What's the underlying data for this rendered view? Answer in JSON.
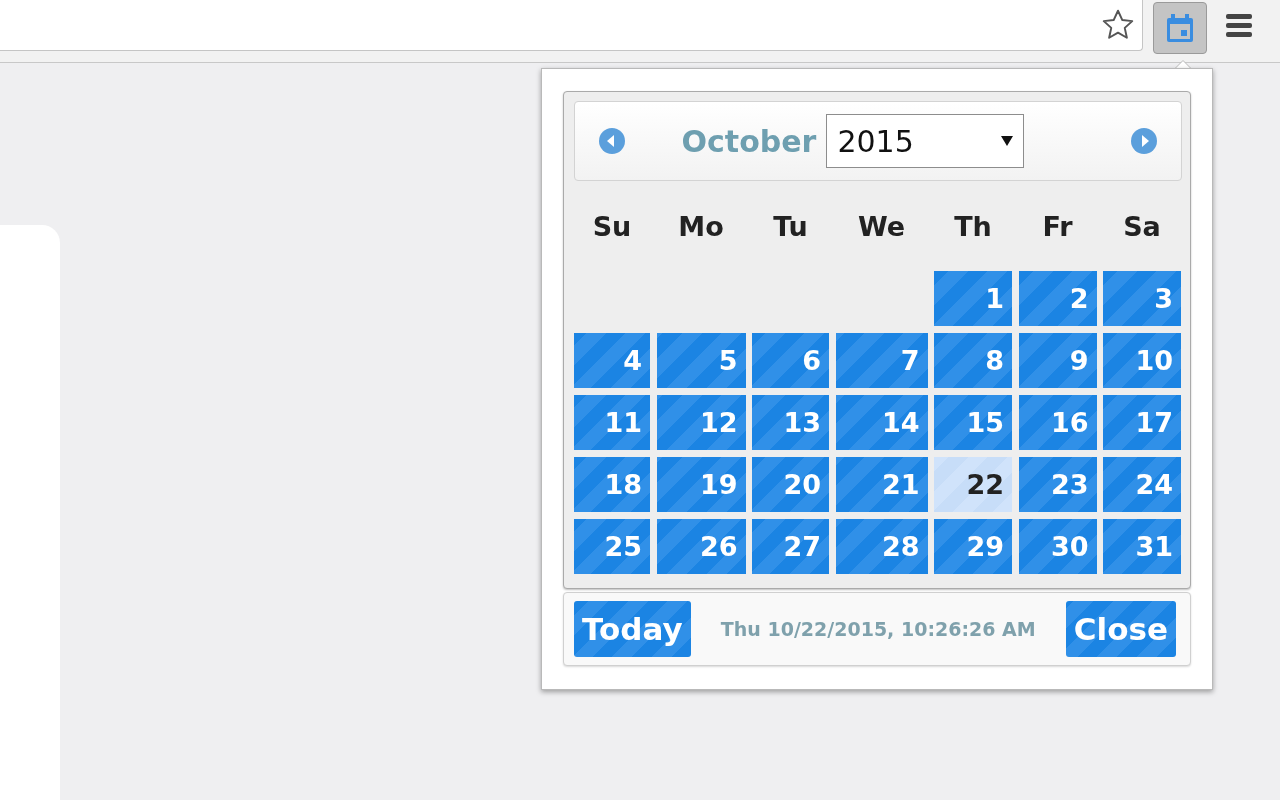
{
  "browser": {
    "extension_pressed": true
  },
  "calendar": {
    "month": "October",
    "year": "2015",
    "weekdays": [
      "Su",
      "Mo",
      "Tu",
      "We",
      "Th",
      "Fr",
      "Sa"
    ],
    "days": [
      {
        "kind": "blank"
      },
      {
        "kind": "blank"
      },
      {
        "kind": "blank"
      },
      {
        "kind": "blank"
      },
      {
        "kind": "day",
        "label": "1",
        "selected": false
      },
      {
        "kind": "day",
        "label": "2",
        "selected": false
      },
      {
        "kind": "day",
        "label": "3",
        "selected": false
      },
      {
        "kind": "day",
        "label": "4",
        "selected": false
      },
      {
        "kind": "day",
        "label": "5",
        "selected": false
      },
      {
        "kind": "day",
        "label": "6",
        "selected": false
      },
      {
        "kind": "day",
        "label": "7",
        "selected": false
      },
      {
        "kind": "day",
        "label": "8",
        "selected": false
      },
      {
        "kind": "day",
        "label": "9",
        "selected": false
      },
      {
        "kind": "day",
        "label": "10",
        "selected": false
      },
      {
        "kind": "day",
        "label": "11",
        "selected": false
      },
      {
        "kind": "day",
        "label": "12",
        "selected": false
      },
      {
        "kind": "day",
        "label": "13",
        "selected": false
      },
      {
        "kind": "day",
        "label": "14",
        "selected": false
      },
      {
        "kind": "day",
        "label": "15",
        "selected": false
      },
      {
        "kind": "day",
        "label": "16",
        "selected": false
      },
      {
        "kind": "day",
        "label": "17",
        "selected": false
      },
      {
        "kind": "day",
        "label": "18",
        "selected": false
      },
      {
        "kind": "day",
        "label": "19",
        "selected": false
      },
      {
        "kind": "day",
        "label": "20",
        "selected": false
      },
      {
        "kind": "day",
        "label": "21",
        "selected": false
      },
      {
        "kind": "day",
        "label": "22",
        "selected": true
      },
      {
        "kind": "day",
        "label": "23",
        "selected": false
      },
      {
        "kind": "day",
        "label": "24",
        "selected": false
      },
      {
        "kind": "day",
        "label": "25",
        "selected": false
      },
      {
        "kind": "day",
        "label": "26",
        "selected": false
      },
      {
        "kind": "day",
        "label": "27",
        "selected": false
      },
      {
        "kind": "day",
        "label": "28",
        "selected": false
      },
      {
        "kind": "day",
        "label": "29",
        "selected": false
      },
      {
        "kind": "day",
        "label": "30",
        "selected": false
      },
      {
        "kind": "day",
        "label": "31",
        "selected": false
      }
    ],
    "footer": {
      "today_button": "Today",
      "now": "Thu 10/22/2015, 10:26:26 AM",
      "close_button": "Close"
    }
  }
}
